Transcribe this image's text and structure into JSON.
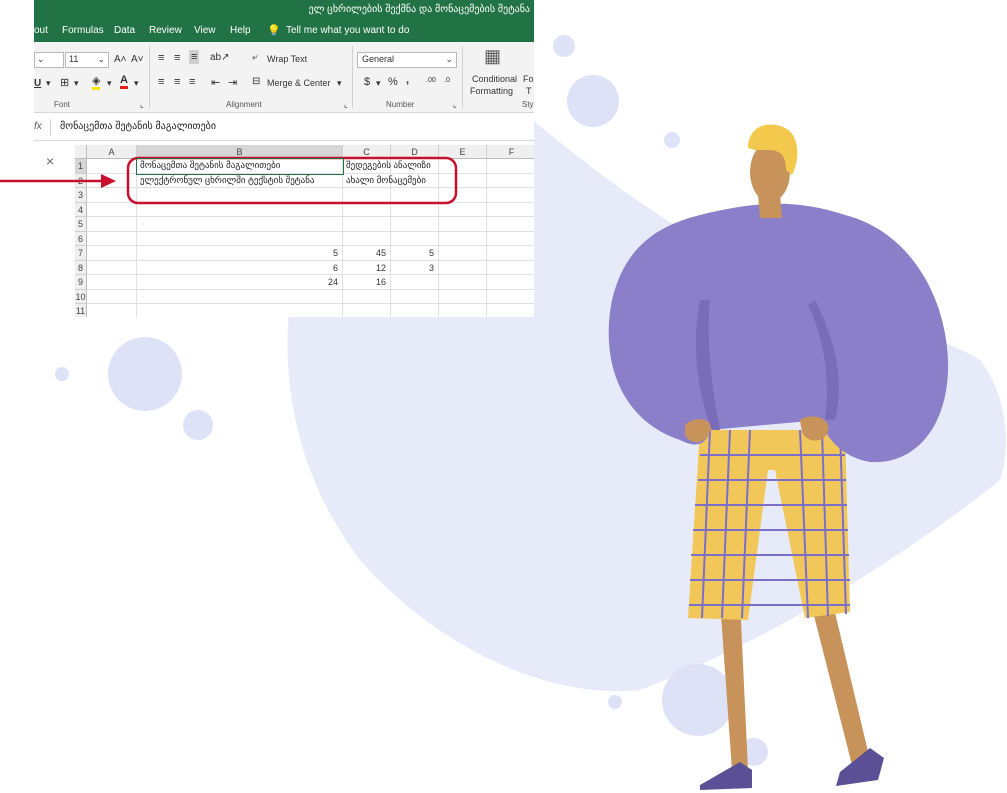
{
  "window": {
    "title": "ელ ცხრილების შექმნა და მონაცემების შეტანა"
  },
  "menu": [
    "out",
    "Formulas",
    "Data",
    "Review",
    "View",
    "Help"
  ],
  "tell_me": "Tell me what you want to do",
  "ribbon": {
    "font_size": "11",
    "wrap_text": "Wrap Text",
    "merge_center": "Merge & Center",
    "number_format": "General",
    "currency": "$",
    "percent": "%",
    "comma": ",",
    "inc_decimal": ".00",
    "dec_decimal": ".0",
    "conditional_1": "Conditional",
    "conditional_2": "Formatting",
    "format_as_1": "Fo",
    "format_as_2": "T",
    "group_font": "Font",
    "group_alignment": "Alignment",
    "group_number": "Number",
    "group_styles": "Styl"
  },
  "formula_bar": {
    "fx": "fx",
    "cancel": "×",
    "content": "მონაცემთა შეტანის მაგალითები"
  },
  "columns": [
    "A",
    "B",
    "C",
    "D",
    "E",
    "F"
  ],
  "rows": [
    "1",
    "2",
    "3",
    "4",
    "5",
    "6",
    "7",
    "8",
    "9",
    "10",
    "11"
  ],
  "cells": {
    "B1": "მონაცემთა შეტანის მაგალითები",
    "C1": "შედეგების ანალიზი",
    "B2": "ელექტრონულ ცხრილში ტექსტის შეტანა",
    "C2": "ახალი მონაცემები",
    "B7": "5",
    "C7": "45",
    "D7": "5",
    "B8": "6",
    "C8": "12",
    "D8": "3",
    "B9": "24",
    "C9": "16"
  },
  "colors": {
    "excel_green": "#217346",
    "annotation_red": "#c8102e",
    "blob": "#e6e9f8",
    "bubble": "#dde2f6",
    "sweater": "#8b7fc9",
    "pants": "#f2c75a",
    "hair": "#f2c94c",
    "skin": "#c8935a",
    "shoes": "#5b4f95"
  }
}
